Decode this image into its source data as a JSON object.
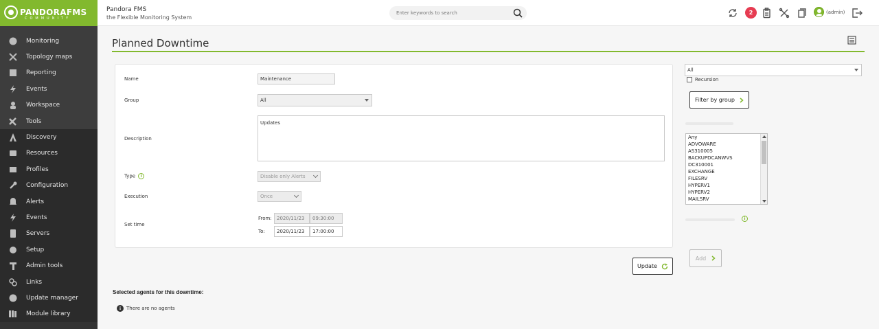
{
  "brand": {
    "name": "PANDORAFMS",
    "edition": "COMMUNITY"
  },
  "header": {
    "app_name": "Pandora FMS",
    "app_tagline": "the Flexible Monitoring System",
    "search_placeholder": "Enter keywords to search",
    "notifications_count": "2",
    "user_label": "(admin)"
  },
  "sidebar": {
    "items": [
      {
        "label": "Monitoring",
        "icon": "monitoring-icon"
      },
      {
        "label": "Topology maps",
        "icon": "topology-icon"
      },
      {
        "label": "Reporting",
        "icon": "reporting-icon"
      },
      {
        "label": "Events",
        "icon": "events-icon"
      },
      {
        "label": "Workspace",
        "icon": "workspace-icon"
      },
      {
        "label": "Tools",
        "icon": "tools-icon"
      },
      {
        "label": "Discovery",
        "icon": "discovery-icon"
      },
      {
        "label": "Resources",
        "icon": "resources-icon"
      },
      {
        "label": "Profiles",
        "icon": "profiles-icon"
      },
      {
        "label": "Configuration",
        "icon": "configuration-icon"
      },
      {
        "label": "Alerts",
        "icon": "alerts-icon"
      },
      {
        "label": "Events",
        "icon": "events-icon"
      },
      {
        "label": "Servers",
        "icon": "servers-icon"
      },
      {
        "label": "Setup",
        "icon": "setup-icon"
      },
      {
        "label": "Admin tools",
        "icon": "admin-tools-icon"
      },
      {
        "label": "Links",
        "icon": "links-icon"
      },
      {
        "label": "Update manager",
        "icon": "update-manager-icon"
      },
      {
        "label": "Module library",
        "icon": "module-library-icon"
      }
    ]
  },
  "page": {
    "title": "Planned Downtime"
  },
  "form": {
    "name_label": "Name",
    "name_value": "Maintenance",
    "group_label": "Group",
    "group_value": "All",
    "description_label": "Description",
    "description_value": "Updates",
    "type_label": "Type",
    "type_value": "Disable only Alerts",
    "execution_label": "Execution",
    "execution_value": "Once",
    "settime_label": "Set time",
    "from_label": "From:",
    "from_date": "2020/11/23",
    "from_time": "09:30:00",
    "to_label": "To:",
    "to_date": "2020/11/23",
    "to_time": "17:00:00",
    "update_button": "Update"
  },
  "right_panel": {
    "group_filter_value": "All",
    "recursion_label": "Recursion",
    "filter_button": "Filter by group",
    "agents": [
      "Any",
      "ADVOWARE",
      "AS310005",
      "BACKUPDCANWVS",
      "DC310001",
      "EXCHANGE",
      "FILESRV",
      "HYPERV1",
      "HYPERV2",
      "MAILSRV"
    ],
    "add_button": "Add"
  },
  "selected": {
    "title": "Selected agents for this downtime:",
    "empty_message": "There are no agents"
  },
  "colors": {
    "accent": "#82b92e",
    "sidebar_bg": "#333333",
    "badge": "#e63c52"
  }
}
